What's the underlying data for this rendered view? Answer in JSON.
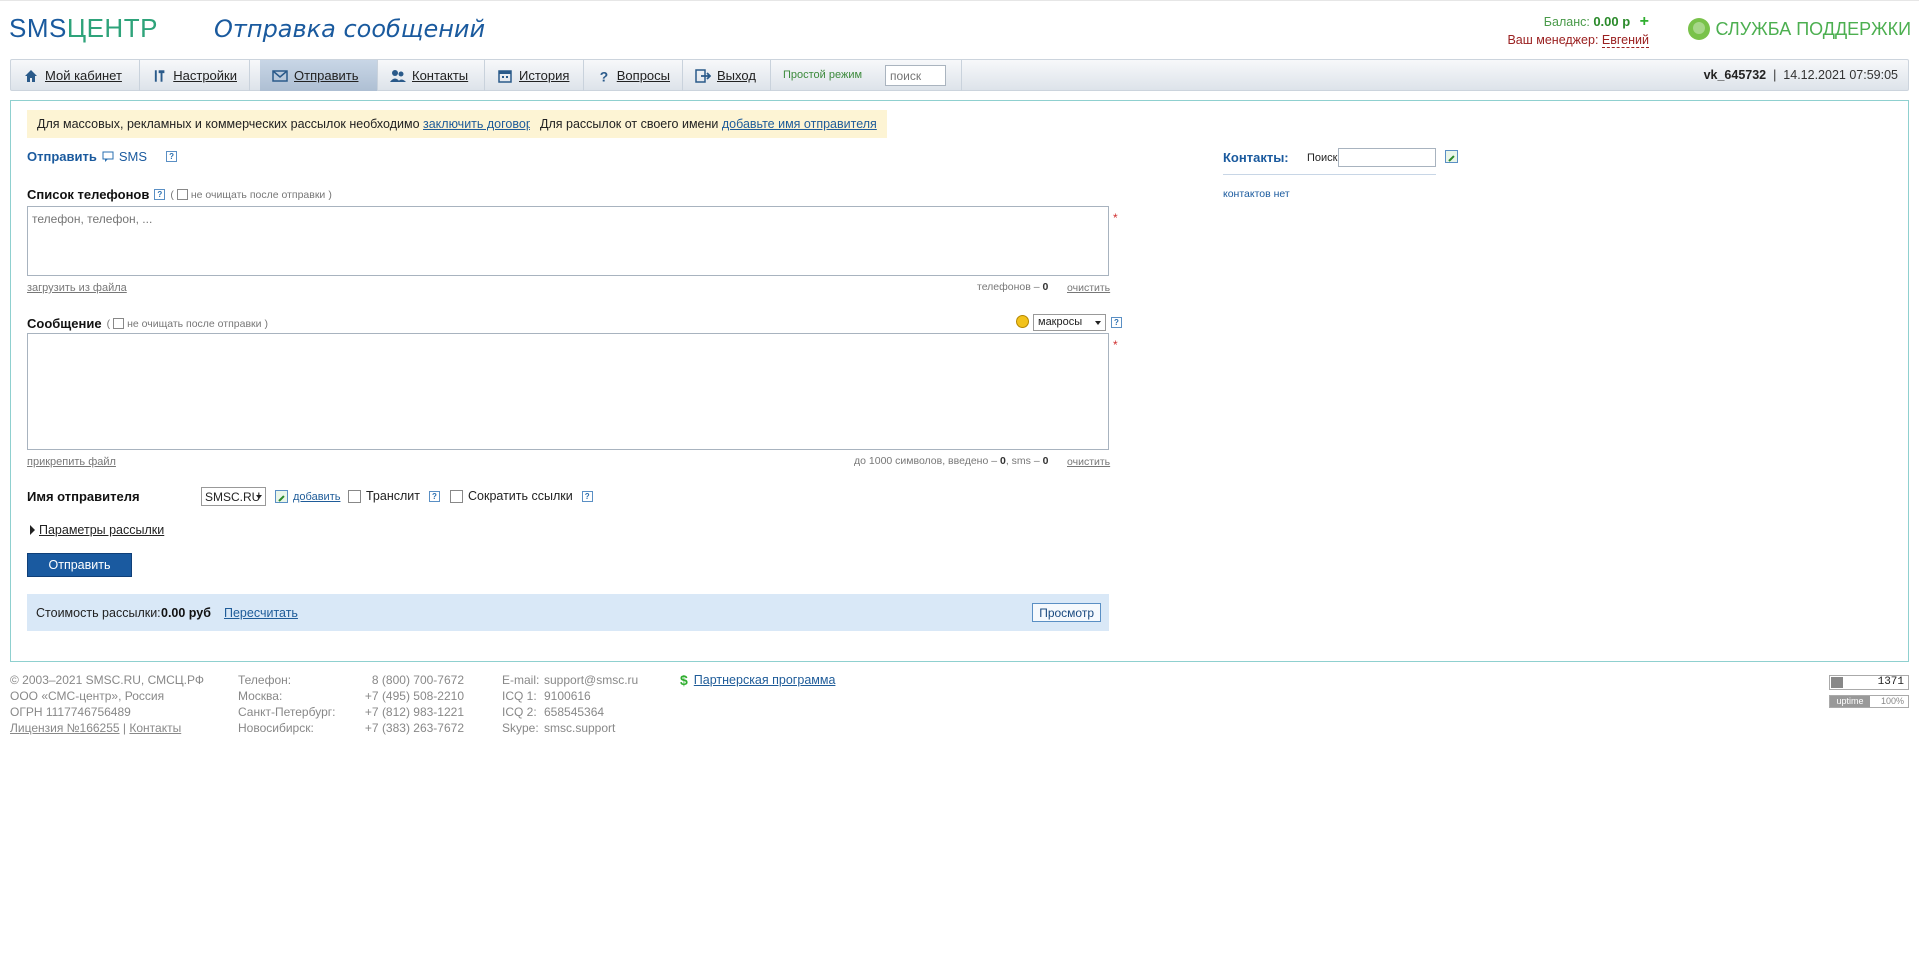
{
  "header": {
    "logo_a": "SMS",
    "logo_b": "ЦЕНТР",
    "page_title": "Отправка сообщений",
    "balance_label": "Баланс:",
    "balance_value": "0.00 р",
    "balance_add": "+",
    "manager_label": "Ваш менеджер:",
    "manager_name": "Евгений",
    "support_label": "СЛУЖБА ПОДДЕРЖКИ"
  },
  "nav": {
    "items": [
      {
        "label": "Мой кабинет",
        "icon": "home-icon"
      },
      {
        "label": "Настройки",
        "icon": "tools-icon"
      },
      {
        "label": "Отправить",
        "icon": "envelope-icon"
      },
      {
        "label": "Контакты",
        "icon": "users-icon"
      },
      {
        "label": "История",
        "icon": "calendar-icon"
      },
      {
        "label": "Вопросы",
        "icon": "question-icon"
      },
      {
        "label": "Выход",
        "icon": "exit-icon"
      }
    ],
    "simple_mode": "Простой режим",
    "search_placeholder": "поиск",
    "username": "vk_645732",
    "separator": "|",
    "datetime": "14.12.2021 07:59:05"
  },
  "notices": {
    "contract_text": "Для массовых, рекламных и коммерческих рассылок необходимо ",
    "contract_link": "заключить договор",
    "sender_text": "Для рассылок от своего имени ",
    "sender_link": "добавьте имя отправителя"
  },
  "form": {
    "send_title": "Отправить",
    "channel": "SMS",
    "phones_label": "Список телефонов",
    "no_clear_label": "не очищать после отправки",
    "phones_placeholder": "телефон, телефон, ...",
    "required_mark": "*",
    "load_file": "загрузить из файла",
    "phones_count_label": "телефонов –",
    "phones_count": "0",
    "clear": "очистить",
    "message_label": "Сообщение",
    "macros": "макросы",
    "attach_file": "прикрепить файл",
    "chars_label": "до 1000 символов, введено –",
    "chars_count": "0",
    "sms_label": ", sms –",
    "sms_count": "0",
    "sender_label": "Имя отправителя",
    "sender_value": "SMSC.RU",
    "add_sender": "добавить",
    "translit": "Транслит",
    "shorten_links": "Сократить ссылки",
    "params": "Параметры рассылки",
    "send_button": "Отправить",
    "cost_label": "Стоимость рассылки:",
    "cost_value": "0.00 руб",
    "recalc": "Пересчитать",
    "preview": "Просмотр"
  },
  "contacts": {
    "title": "Контакты:",
    "search_label": "Поиск",
    "empty": "контактов нет"
  },
  "footer": {
    "copy1": "© 2003–2021 SMSC.RU, СМСЦ.РФ",
    "copy2": "ООО «СМС-центр», Россия",
    "copy3": "ОГРН 1117746756489",
    "license": "Лицензия №166255",
    "sep": "|",
    "contacts_link": "Контакты",
    "phones": [
      {
        "label": "Телефон:",
        "value": "8 (800) 700-7672"
      },
      {
        "label": "Москва:",
        "value": "+7 (495) 508-2210"
      },
      {
        "label": "Санкт-Петербург:",
        "value": "+7 (812) 983-1221"
      },
      {
        "label": "Новосибирск:",
        "value": "+7 (383) 263-7672"
      }
    ],
    "contacts_list": [
      {
        "label": "E-mail:",
        "value": "support@smsc.ru"
      },
      {
        "label": "ICQ 1:",
        "value": "9100616"
      },
      {
        "label": "ICQ 2:",
        "value": "658545364"
      },
      {
        "label": "Skype:",
        "value": "smsc.support"
      }
    ],
    "partner": "Партнерская программа",
    "partner_icon": "$",
    "counter": "1371",
    "uptime_label": "uptime",
    "uptime_value": "100%"
  }
}
